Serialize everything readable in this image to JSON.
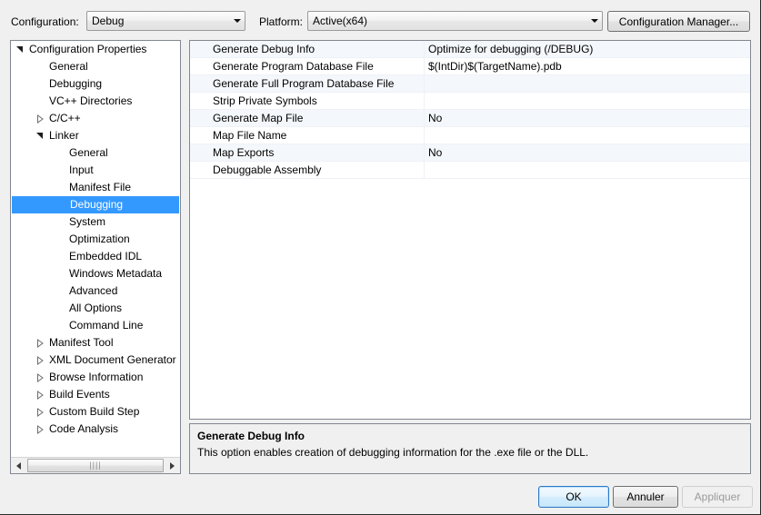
{
  "toolbar": {
    "configuration_label": "Configuration:",
    "configuration_value": "Debug",
    "platform_label": "Platform:",
    "platform_value": "Active(x64)",
    "configuration_manager_label": "Configuration Manager..."
  },
  "tree": {
    "selected": "Debugging",
    "items": [
      {
        "label": "Configuration Properties",
        "indent": 0,
        "glyph": "expanded"
      },
      {
        "label": "General",
        "indent": 1,
        "glyph": "none"
      },
      {
        "label": "Debugging",
        "indent": 1,
        "glyph": "none"
      },
      {
        "label": "VC++ Directories",
        "indent": 1,
        "glyph": "none"
      },
      {
        "label": "C/C++",
        "indent": 1,
        "glyph": "collapsed"
      },
      {
        "label": "Linker",
        "indent": 1,
        "glyph": "expanded"
      },
      {
        "label": "General",
        "indent": 2,
        "glyph": "none"
      },
      {
        "label": "Input",
        "indent": 2,
        "glyph": "none"
      },
      {
        "label": "Manifest File",
        "indent": 2,
        "glyph": "none"
      },
      {
        "label": "Debugging",
        "indent": 2,
        "glyph": "none",
        "selected": true
      },
      {
        "label": "System",
        "indent": 2,
        "glyph": "none"
      },
      {
        "label": "Optimization",
        "indent": 2,
        "glyph": "none"
      },
      {
        "label": "Embedded IDL",
        "indent": 2,
        "glyph": "none"
      },
      {
        "label": "Windows Metadata",
        "indent": 2,
        "glyph": "none"
      },
      {
        "label": "Advanced",
        "indent": 2,
        "glyph": "none"
      },
      {
        "label": "All Options",
        "indent": 2,
        "glyph": "none"
      },
      {
        "label": "Command Line",
        "indent": 2,
        "glyph": "none"
      },
      {
        "label": "Manifest Tool",
        "indent": 1,
        "glyph": "collapsed"
      },
      {
        "label": "XML Document Generator",
        "indent": 1,
        "glyph": "collapsed"
      },
      {
        "label": "Browse Information",
        "indent": 1,
        "glyph": "collapsed"
      },
      {
        "label": "Build Events",
        "indent": 1,
        "glyph": "collapsed"
      },
      {
        "label": "Custom Build Step",
        "indent": 1,
        "glyph": "collapsed"
      },
      {
        "label": "Code Analysis",
        "indent": 1,
        "glyph": "collapsed"
      }
    ],
    "hscroll": {
      "left_arrow": "left-arrow-icon",
      "right_arrow": "right-arrow-icon",
      "grip": "||||"
    }
  },
  "grid": {
    "rows": [
      {
        "name": "Generate Debug Info",
        "value": "Optimize for debugging (/DEBUG)"
      },
      {
        "name": "Generate Program Database File",
        "value": "$(IntDir)$(TargetName).pdb"
      },
      {
        "name": "Generate Full Program Database File",
        "value": ""
      },
      {
        "name": "Strip Private Symbols",
        "value": ""
      },
      {
        "name": "Generate Map File",
        "value": "No"
      },
      {
        "name": "Map File Name",
        "value": ""
      },
      {
        "name": "Map Exports",
        "value": "No"
      },
      {
        "name": "Debuggable Assembly",
        "value": ""
      }
    ]
  },
  "description": {
    "title": "Generate Debug Info",
    "body": "This option enables creation of debugging information for the .exe file or the DLL."
  },
  "buttons": {
    "ok": "OK",
    "cancel": "Annuler",
    "apply": "Appliquer"
  },
  "colors": {
    "selection_blue": "#3399ff",
    "dialog_bg": "#f0f0f0",
    "grid_alt_row": "#f4f7fb",
    "panel_border": "#828790",
    "ok_border": "#2c79c4"
  }
}
